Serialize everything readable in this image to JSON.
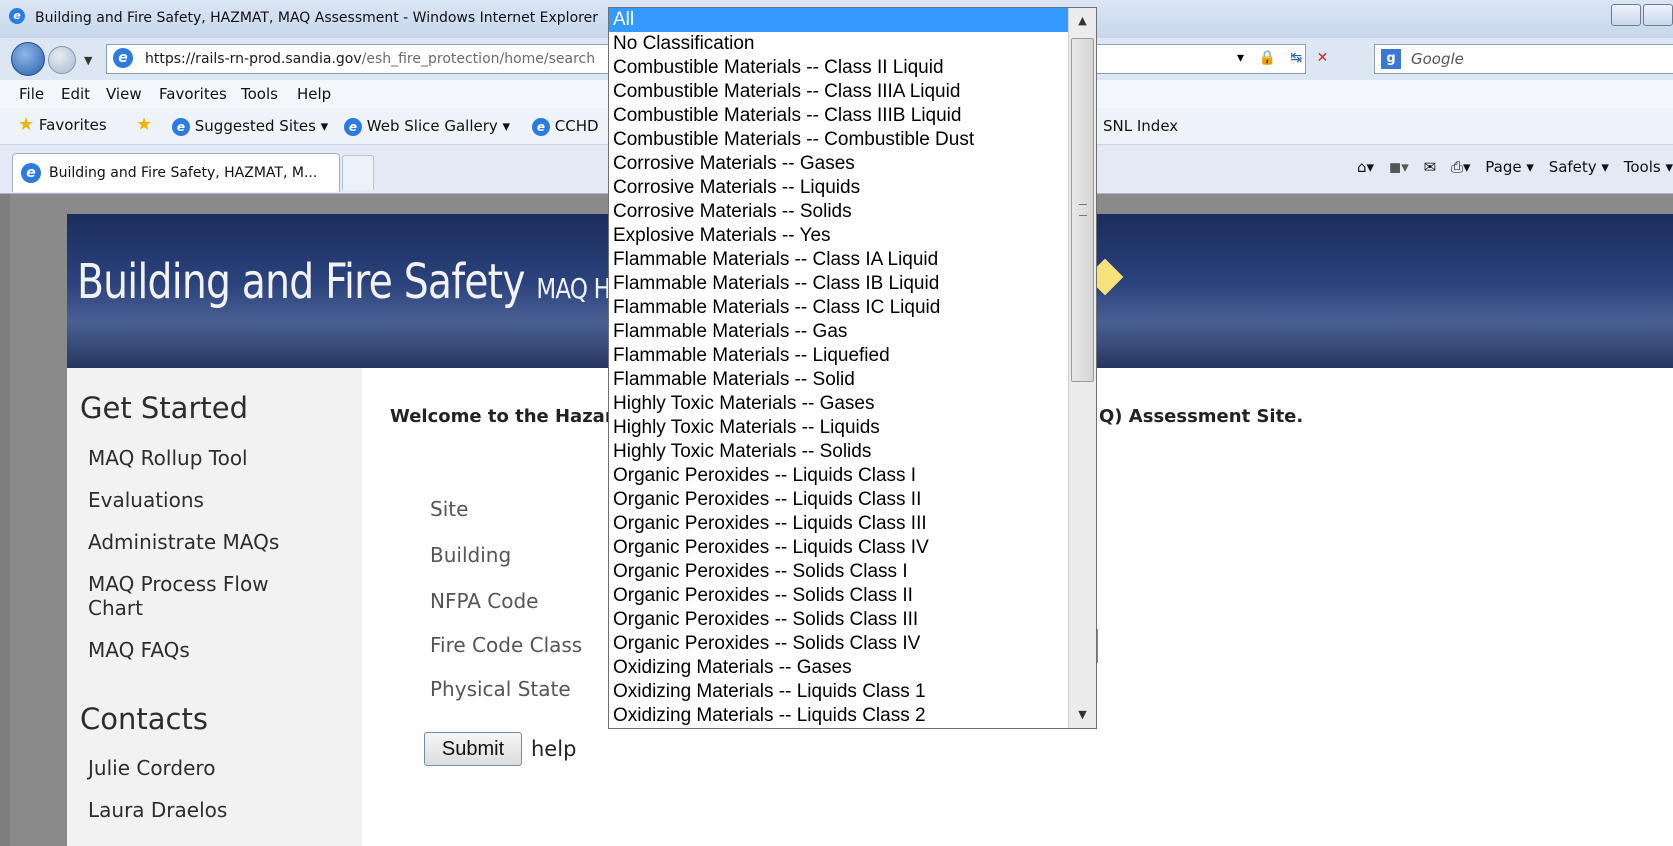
{
  "window": {
    "title": "Building and Fire Safety, HAZMAT, MAQ Assessment - Windows Internet Explorer",
    "icon": "ie-icon"
  },
  "address": {
    "url_host": "https://rails-rn-prod.sandia.gov",
    "url_path": "/esh_fire_protection/home/search",
    "search_placeholder": "Google"
  },
  "menu": [
    "File",
    "Edit",
    "View",
    "Favorites",
    "Tools",
    "Help"
  ],
  "favorites": {
    "label": "Favorites",
    "items": [
      "Suggested Sites ▾",
      "Web Slice Gallery ▾",
      "CCHD",
      "SNL Index"
    ]
  },
  "tab": {
    "label": "Building and Fire Safety, HAZMAT, M..."
  },
  "command_bar": {
    "page": "Page ▾",
    "safety": "Safety ▾",
    "tools": "Tools ▾"
  },
  "banner": {
    "title": "Building and Fire Safety",
    "subtitle": "MAQ H"
  },
  "sidebar": {
    "get_started_title": "Get Started",
    "links": [
      "MAQ Rollup Tool",
      "Evaluations",
      "Administrate MAQs",
      "MAQ Process Flow Chart",
      "MAQ FAQs"
    ],
    "contacts_title": "Contacts",
    "contacts": [
      "Julie Cordero",
      "Laura Draelos"
    ]
  },
  "main": {
    "welcome_left": "Welcome to the Hazar",
    "welcome_right": "Q) Assessment Site.",
    "labels": {
      "site": "Site",
      "building": "Building",
      "nfpa": "NFPA Code",
      "fire_class": "Fire Code Class",
      "physical_state": "Physical State"
    },
    "submit": "Submit",
    "help": "help"
  },
  "dropdown": {
    "selected": "All",
    "options": [
      "All",
      "No Classification",
      "Combustible Materials -- Class II Liquid",
      "Combustible Materials -- Class IIIA Liquid",
      "Combustible Materials -- Class IIIB Liquid",
      "Combustible Materials -- Combustible Dust",
      "Corrosive Materials -- Gases",
      "Corrosive Materials -- Liquids",
      "Corrosive Materials -- Solids",
      "Explosive Materials -- Yes",
      "Flammable Materials -- Class IA Liquid",
      "Flammable Materials -- Class IB Liquid",
      "Flammable Materials -- Class IC Liquid",
      "Flammable Materials -- Gas",
      "Flammable Materials -- Liquefied",
      "Flammable Materials -- Solid",
      "Highly Toxic Materials -- Gases",
      "Highly Toxic Materials -- Liquids",
      "Highly Toxic Materials -- Solids",
      "Organic Peroxides -- Liquids Class I",
      "Organic Peroxides -- Liquids Class II",
      "Organic Peroxides -- Liquids Class III",
      "Organic Peroxides -- Liquids Class IV",
      "Organic Peroxides -- Solids Class I",
      "Organic Peroxides -- Solids Class II",
      "Organic Peroxides -- Solids Class III",
      "Organic Peroxides -- Solids Class IV",
      "Oxidizing Materials -- Gases",
      "Oxidizing Materials -- Liquids Class 1",
      "Oxidizing Materials -- Liquids Class 2"
    ]
  }
}
